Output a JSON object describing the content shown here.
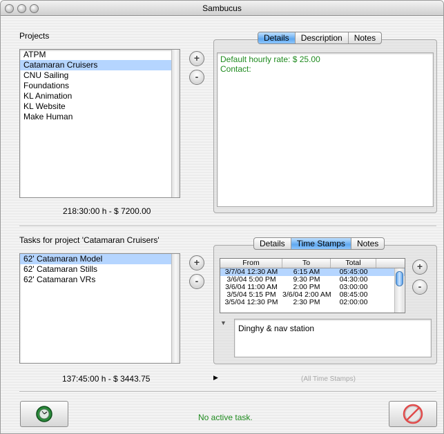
{
  "window": {
    "title": "Sambucus"
  },
  "projects": {
    "heading": "Projects",
    "items": [
      "ATPM",
      "Catamaran Cruisers",
      "CNU Sailing",
      "Foundations",
      "KL Animation",
      "KL Website",
      "Make Human"
    ],
    "selected_index": 1,
    "total": "218:30:00 h - $ 7200.00",
    "add_label": "+",
    "remove_label": "-",
    "tabs": [
      "Details",
      "Description",
      "Notes"
    ],
    "active_tab": 0,
    "details": {
      "rate": "Default hourly rate: $ 25.00",
      "contact": "Contact:"
    }
  },
  "tasks": {
    "heading": "Tasks for project 'Catamaran Cruisers'",
    "items": [
      "62' Catamaran Model",
      "62' Catamaran Stills",
      "62' Catamaran VRs"
    ],
    "selected_index": 0,
    "total": "137:45:00 h - $ 3443.75",
    "add_label": "+",
    "remove_label": "-",
    "tabs": [
      "Details",
      "Time Stamps",
      "Notes"
    ],
    "active_tab": 1,
    "timestamps": {
      "columns": [
        "From",
        "To",
        "Total"
      ],
      "rows": [
        [
          "3/7/04 12:30 AM",
          "6:15 AM",
          "05:45:00"
        ],
        [
          "3/6/04 5:00 PM",
          "9:30 PM",
          "04:30:00"
        ],
        [
          "3/6/04 11:00 AM",
          "2:00 PM",
          "03:00:00"
        ],
        [
          "3/5/04 5:15 PM",
          "3/6/04 2:00 AM",
          "08:45:00"
        ],
        [
          "3/5/04 12:30 PM",
          "2:30 PM",
          "02:00:00"
        ]
      ],
      "selected_index": 0,
      "note": "Dinghy & nav station",
      "footer": "(All Time Stamps)",
      "ts_add_label": "+",
      "ts_remove_label": "-"
    }
  },
  "status": {
    "text": "No active task."
  },
  "icons": {
    "start": "stopwatch-icon",
    "stop": "stop-timer-icon"
  },
  "colors": {
    "selection": "#b5d5ff",
    "status_green": "#1e8a1e",
    "tab_active": "#5fa8ef"
  }
}
